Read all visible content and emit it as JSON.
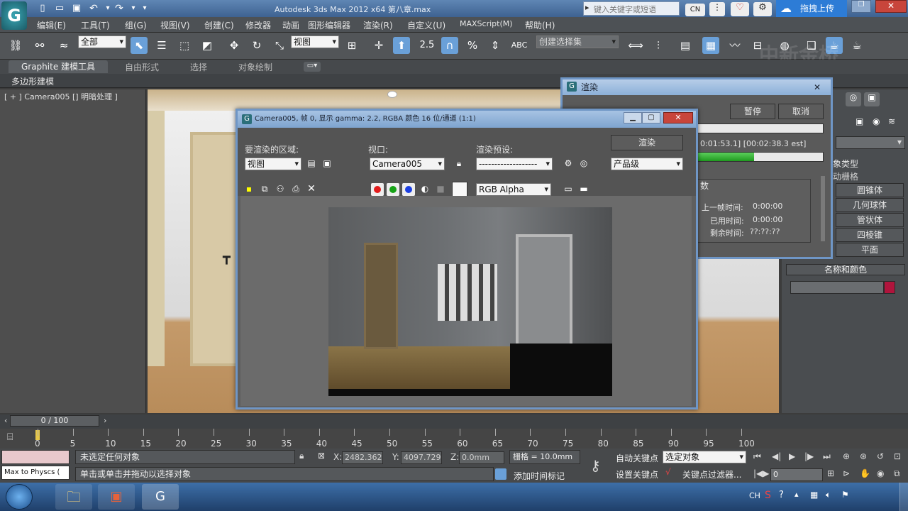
{
  "window": {
    "title": "Autodesk 3ds Max  2012 x64      第八章.max"
  },
  "title_search": {
    "placeholder": "键入关键字或短语"
  },
  "title_buttons": {
    "cn": "CN",
    "upload": "拖拽上传"
  },
  "menu": [
    "编辑(E)",
    "工具(T)",
    "组(G)",
    "视图(V)",
    "创建(C)",
    "修改器",
    "动画",
    "图形编辑器",
    "渲染(R)",
    "自定义(U)",
    "MAXScript(M)",
    "帮助(H)"
  ],
  "toolbar": {
    "filter_select": "全部",
    "coord_select": "视图",
    "selection_set": "创建选择集",
    "snap_value": "2.5"
  },
  "ribbon": {
    "tabs": [
      "Graphite 建模工具",
      "自由形式",
      "选择",
      "对象绘制"
    ],
    "sub": "多边形建模"
  },
  "viewport": {
    "label": "[ + ] Camera005 [] 明暗处理 ]"
  },
  "render_frame": {
    "title": "Camera005, 帧 0, 显示 gamma: 2.2, RGBA 颜色 16 位/通道 (1:1)",
    "area_label": "要渲染的区域:",
    "area_value": "视图",
    "viewport_label": "视口:",
    "viewport_value": "Camera005",
    "preset_label": "渲染预设:",
    "preset_value": "-------------------",
    "render_button": "渲染",
    "quality_value": "产品级",
    "channel_value": "RGB Alpha"
  },
  "render_progress": {
    "title": "渲染",
    "pause": "暂停",
    "cancel": "取消",
    "time_text": "0:01:53.1] [00:02:38.3 est]",
    "progress": 0.45,
    "section": "数",
    "last_frame_label": "上一帧时间:",
    "last_frame_value": "0:00:00",
    "elapsed_label": "已用时间:",
    "elapsed_value": "0:00:00",
    "remaining_label": "剩余时间:",
    "remaining_value": "??:??:??"
  },
  "command_panel": {
    "object_type": "象类型",
    "auto_grid": "动栅格",
    "items": [
      "圆锥体",
      "几何球体",
      "管状体",
      "四棱锥",
      "平面"
    ],
    "name_color": "名称和颜色",
    "swatch_color": "#b0143c"
  },
  "time_slider": {
    "value": "0 / 100"
  },
  "trackbar": {
    "ticks": [
      "0",
      "5",
      "10",
      "15",
      "20",
      "25",
      "30",
      "35",
      "40",
      "45",
      "50",
      "55",
      "60",
      "65",
      "70",
      "75",
      "80",
      "85",
      "90",
      "95",
      "100"
    ]
  },
  "status": {
    "selection": "未选定任何对象",
    "prompt": "单击或单击并拖动以选择对象",
    "script_listener": "Max to Physcs (",
    "x": "2482.362m",
    "y": "4097.729m",
    "z": "0.0mm",
    "grid": "栅格 = 10.0mm",
    "add_time_tag": "添加时间标记",
    "auto_key": "自动关键点",
    "set_key": "设置关键点",
    "selected_object": "选定对象",
    "key_filter": "关键点过滤器...",
    "frame": "0"
  },
  "taskbar": {
    "lang": "CH"
  },
  "watermark": "中新金桥"
}
